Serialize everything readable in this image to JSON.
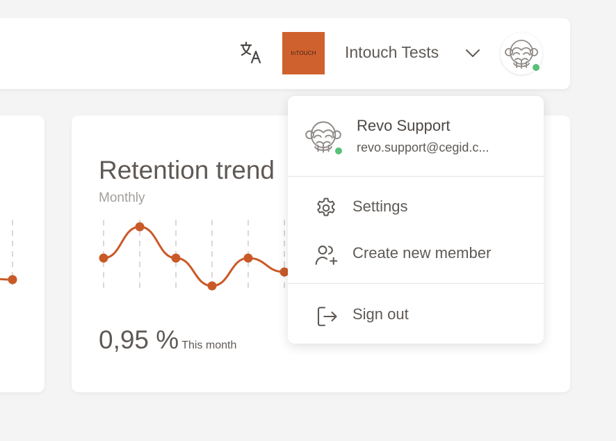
{
  "header": {
    "org_logo_text": "InTOUCH",
    "org_name": "Intouch Tests",
    "org_logo_color": "#cf612e",
    "status_color": "#59c07a",
    "icons": [
      "translate-icon",
      "chevron-down-icon",
      "monkey-avatar-icon"
    ]
  },
  "retention_card": {
    "title": "Retention trend",
    "subtitle": "Monthly",
    "value": "0,95 %",
    "value_caption": "This month"
  },
  "chart_data": {
    "type": "line",
    "title": "Retention trend",
    "subtitle": "Monthly",
    "x": [
      0,
      1,
      2,
      3,
      4,
      5
    ],
    "values": [
      0.55,
      1.0,
      0.55,
      0.15,
      0.55,
      0.35
    ],
    "ylim": [
      0,
      1
    ],
    "line_color": "#c95a28",
    "grid": "vertical dashed"
  },
  "left_chart": {
    "points": [
      0.3
    ]
  },
  "user_menu": {
    "user_name": "Revo Support",
    "user_email": "revo.support@cegid.c...",
    "items": [
      {
        "label": "Settings",
        "icon": "gear-icon"
      },
      {
        "label": "Create new member",
        "icon": "add-user-icon"
      },
      {
        "label": "Sign out",
        "icon": "sign-out-icon"
      }
    ]
  }
}
